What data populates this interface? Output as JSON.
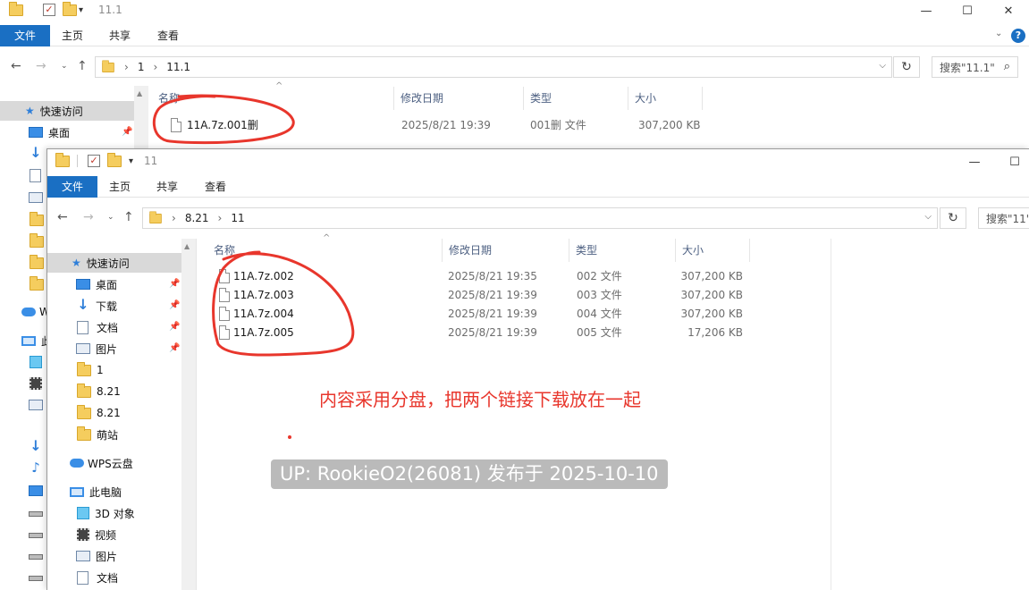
{
  "window_back": {
    "title": "11.1",
    "ribbon_tabs": [
      {
        "label": "文件",
        "active": true
      },
      {
        "label": "主页",
        "active": false
      },
      {
        "label": "共享",
        "active": false
      },
      {
        "label": "查看",
        "active": false
      }
    ],
    "address": [
      "1",
      "11.1"
    ],
    "search_placeholder": "搜索\"11.1\"",
    "columns": [
      "名称",
      "修改日期",
      "类型",
      "大小"
    ],
    "files": [
      {
        "name": "11A.7z.001删",
        "date": "2025/8/21 19:39",
        "type": "001删 文件",
        "size": "307,200 KB"
      }
    ],
    "nav": [
      {
        "label": "快速访问",
        "icon": "star-icon",
        "selected": true
      },
      {
        "label": "桌面",
        "icon": "desktop-icon",
        "pinned": true
      }
    ],
    "nav_partial": [
      {
        "label": "W",
        "icon": "cloud-icon"
      },
      {
        "label": "此",
        "icon": "pc-icon"
      }
    ]
  },
  "window_front": {
    "title": "11",
    "ribbon_tabs": [
      {
        "label": "文件",
        "active": true
      },
      {
        "label": "主页",
        "active": false
      },
      {
        "label": "共享",
        "active": false
      },
      {
        "label": "查看",
        "active": false
      }
    ],
    "address": [
      "8.21",
      "11"
    ],
    "search_placeholder": "搜索\"11\"",
    "columns": [
      "名称",
      "修改日期",
      "类型",
      "大小"
    ],
    "files": [
      {
        "name": "11A.7z.002",
        "date": "2025/8/21 19:35",
        "type": "002 文件",
        "size": "307,200 KB"
      },
      {
        "name": "11A.7z.003",
        "date": "2025/8/21 19:39",
        "type": "003 文件",
        "size": "307,200 KB"
      },
      {
        "name": "11A.7z.004",
        "date": "2025/8/21 19:39",
        "type": "004 文件",
        "size": "307,200 KB"
      },
      {
        "name": "11A.7z.005",
        "date": "2025/8/21 19:39",
        "type": "005 文件",
        "size": "17,206 KB"
      }
    ],
    "nav": {
      "quick_access": "快速访问",
      "desktop": "桌面",
      "downloads": "下载",
      "documents": "文档",
      "pictures": "图片",
      "folder_1": "1",
      "folder_821a": "8.21",
      "folder_821b": "8.21",
      "folder_mengzhan": "萌站",
      "wps_cloud": "WPS云盘",
      "this_pc": "此电脑",
      "objects_3d": "3D 对象",
      "videos": "视频",
      "pictures_pc": "图片",
      "documents_pc": "文档"
    }
  },
  "overlay": {
    "caption": "内容采用分盘，把两个链接下载放在一起",
    "watermark": "UP: RookieO2(26081) 发布于 2025-10-10",
    "annotation_color": "#e8362c"
  }
}
